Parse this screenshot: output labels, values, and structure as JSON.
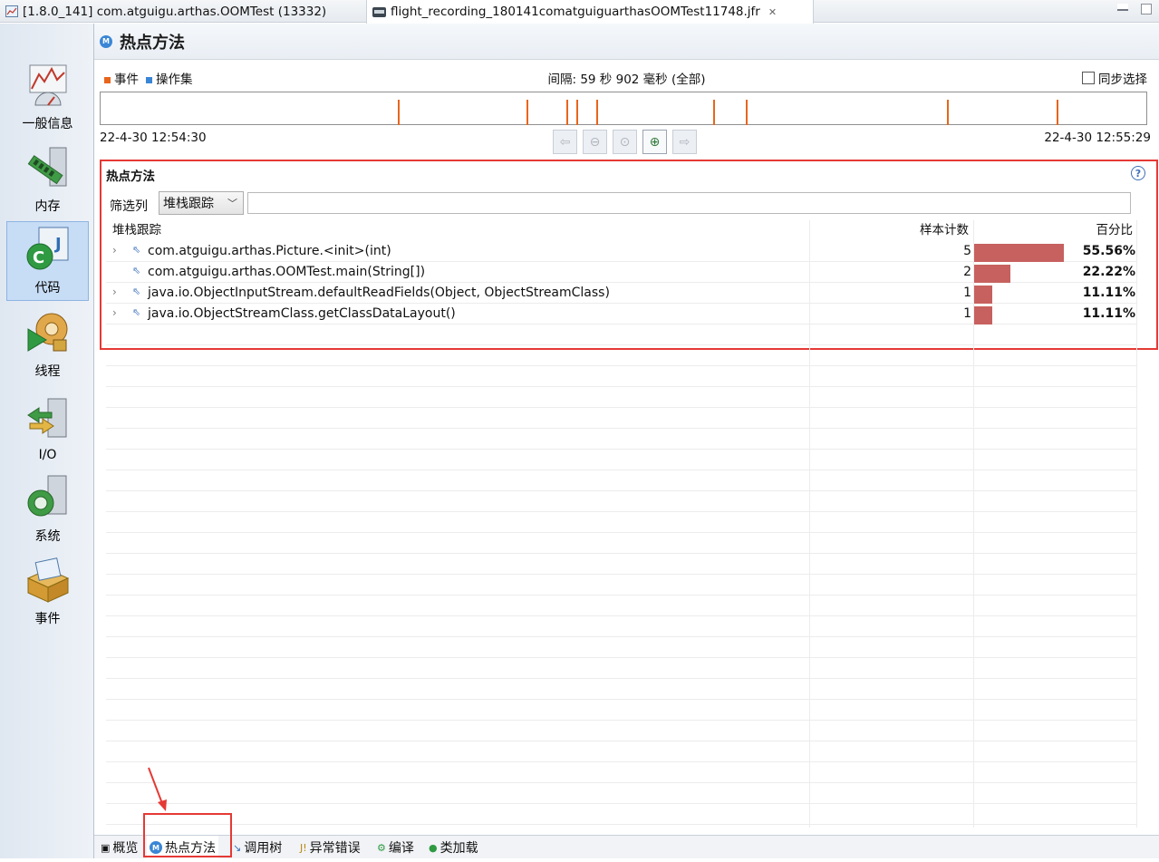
{
  "tabs": [
    {
      "label": "[1.8.0_141] com.atguigu.arthas.OOMTest (13332)"
    },
    {
      "label": "flight_recording_180141comatguiguarthasOOMTest11748.jfr"
    }
  ],
  "nav": [
    {
      "label": "一般信息",
      "icon": "chart-icon"
    },
    {
      "label": "内存",
      "icon": "memory-icon"
    },
    {
      "label": "代码",
      "icon": "code-icon"
    },
    {
      "label": "线程",
      "icon": "thread-icon"
    },
    {
      "label": "I/O",
      "icon": "io-icon"
    },
    {
      "label": "系统",
      "icon": "system-icon"
    },
    {
      "label": "事件",
      "icon": "event-icon"
    }
  ],
  "page": {
    "title": "热点方法",
    "legend_events": "事件",
    "legend_opset": "操作集",
    "interval": "间隔: 59 秒 902 毫秒 (全部)",
    "sync_select": "同步选择",
    "time_start": "22-4-30 12:54:30",
    "time_end": "22-4-30 12:55:29"
  },
  "colors": {
    "event_marker": "#e8651c",
    "opset_marker": "#3a86d6",
    "bar": "#c6615f",
    "highlight": "#e53935"
  },
  "section": {
    "title": "热点方法",
    "filter_label": "筛选列",
    "filter_value": "堆栈跟踪",
    "filter_text": ""
  },
  "table": {
    "headers": {
      "stack": "堆栈跟踪",
      "count": "样本计数",
      "percent": "百分比"
    },
    "rows": [
      {
        "method": "com.atguigu.arthas.Picture.<init>(int)",
        "count": "5",
        "percent": "55.56%",
        "share": 0.5556,
        "expandable": true
      },
      {
        "method": "com.atguigu.arthas.OOMTest.main(String[])",
        "count": "2",
        "percent": "22.22%",
        "share": 0.2222,
        "expandable": false
      },
      {
        "method": "java.io.ObjectInputStream.defaultReadFields(Object, ObjectStreamClass)",
        "count": "1",
        "percent": "11.11%",
        "share": 0.1111,
        "expandable": true
      },
      {
        "method": "java.io.ObjectStreamClass.getClassDataLayout()",
        "count": "1",
        "percent": "11.11%",
        "share": 0.1111,
        "expandable": true
      }
    ]
  },
  "bottom_tabs": [
    {
      "label": "概览",
      "icon": "overview-icon"
    },
    {
      "label": "热点方法",
      "icon": "hot-methods-icon"
    },
    {
      "label": "调用树",
      "icon": "call-tree-icon"
    },
    {
      "label": "异常错误",
      "icon": "exception-icon"
    },
    {
      "label": "编译",
      "icon": "compile-icon"
    },
    {
      "label": "类加载",
      "icon": "class-loading-icon"
    }
  ]
}
